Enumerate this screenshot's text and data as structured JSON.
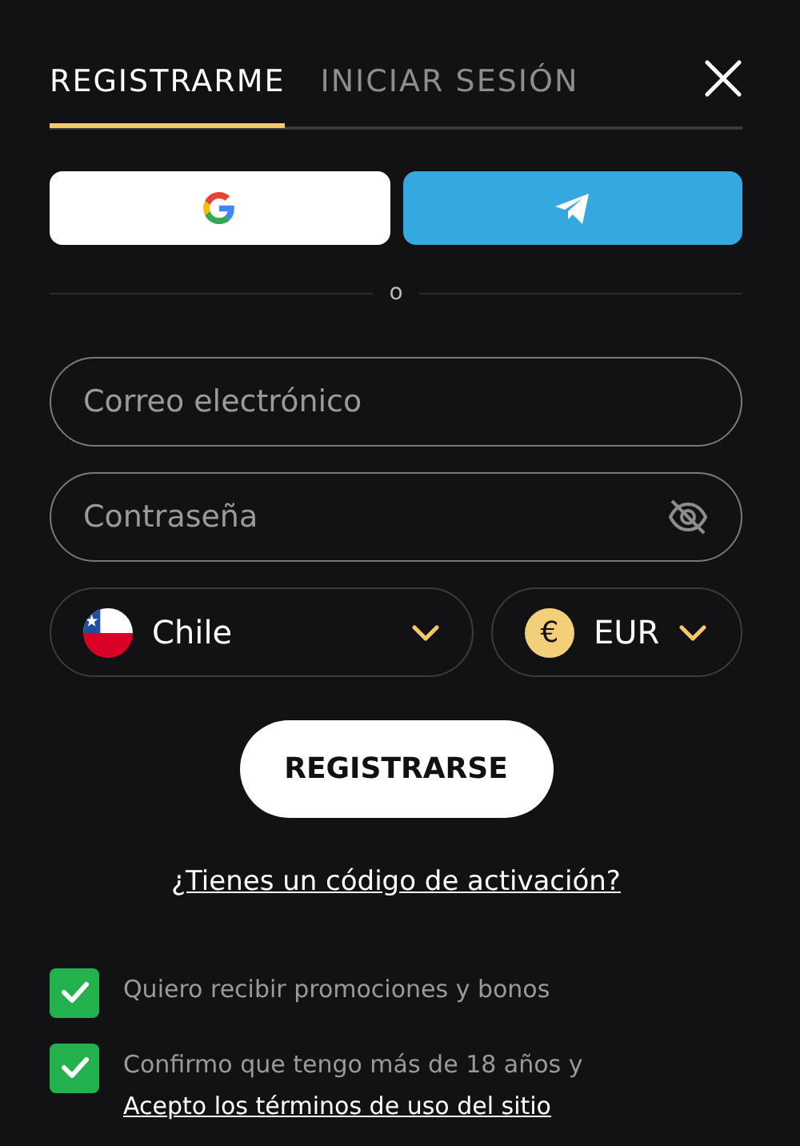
{
  "tabs": [
    {
      "label": "REGISTRARME",
      "selected": true
    },
    {
      "label": "INICIAR SESIÓN",
      "selected": false
    }
  ],
  "divider_text": "o",
  "fields": [
    {
      "placeholder": "Correo electrónico",
      "kind": "email"
    },
    {
      "placeholder": "Contraseña",
      "kind": "password"
    }
  ],
  "country": {
    "value": "Chile"
  },
  "currency": {
    "value": "EUR",
    "symbol": "€"
  },
  "submit": "REGISTRARSE",
  "activation_link": "¿Tienes un código de activación?",
  "checkboxes": [
    {
      "text": "Quiero recibir promociones y bonos",
      "checked": true
    },
    {
      "text": "Confirmo que tengo más de 18 años y",
      "link": "Acepto los términos de uso del sitio",
      "checked": true
    }
  ]
}
